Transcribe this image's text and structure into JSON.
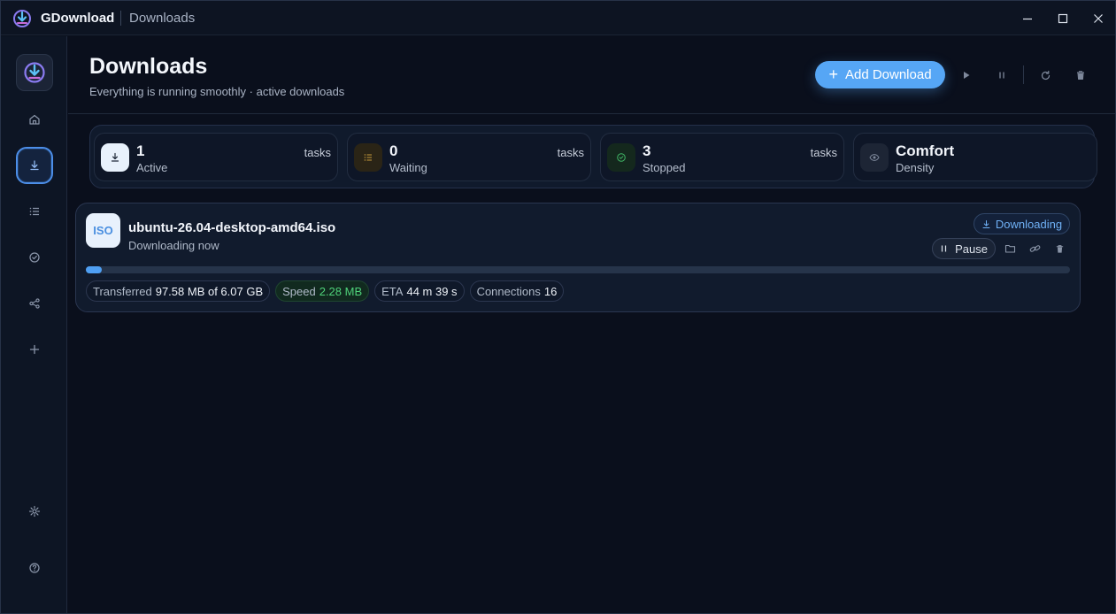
{
  "titlebar": {
    "app_name": "GDownload",
    "page_name": "Downloads"
  },
  "header": {
    "title": "Downloads",
    "subtitle": "Everything is running smoothly · active downloads",
    "add_button": "Add Download"
  },
  "stats": [
    {
      "value": "1",
      "label": "Active",
      "unit": "tasks",
      "icon": "download-icon",
      "color": "#e8f1fc"
    },
    {
      "value": "0",
      "label": "Waiting",
      "unit": "tasks",
      "icon": "list-icon",
      "color": "#2a2416"
    },
    {
      "value": "3",
      "label": "Stopped",
      "unit": "tasks",
      "icon": "check-circle-icon",
      "color": "#14281d"
    },
    {
      "value": "Comfort",
      "label": "Density",
      "unit": "",
      "icon": "eye-icon",
      "color": "#1d2535"
    }
  ],
  "download": {
    "type_label": "ISO",
    "file_name": "ubuntu-26.04-desktop-amd64.iso",
    "status": "Downloading now",
    "badge": "Downloading",
    "pause_label": "Pause",
    "progress": 0.016,
    "transferred_label": "Transferred",
    "transferred_value": "97.58 MB of 6.07 GB",
    "speed_label": "Speed",
    "speed_value": "2.28 MB",
    "eta_label": "ETA",
    "eta_value": "44 m 39 s",
    "connections_label": "Connections",
    "connections_value": "16"
  },
  "colors": {
    "accent": "#56a6f5",
    "speed_green": "#4fd27a",
    "background": "#0a0f1c"
  }
}
